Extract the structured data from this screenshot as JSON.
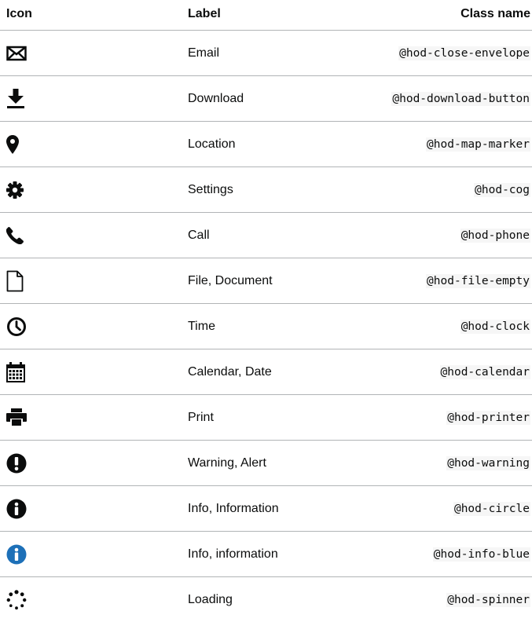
{
  "table": {
    "headers": {
      "icon": "Icon",
      "label": "Label",
      "class_name": "Class name"
    },
    "rows": [
      {
        "icon": "envelope-icon",
        "label": "Email",
        "class_name": "@hod-close-envelope"
      },
      {
        "icon": "download-icon",
        "label": "Download",
        "class_name": "@hod-download-button"
      },
      {
        "icon": "map-marker-icon",
        "label": "Location",
        "class_name": "@hod-map-marker"
      },
      {
        "icon": "cog-icon",
        "label": "Settings",
        "class_name": "@hod-cog"
      },
      {
        "icon": "phone-icon",
        "label": "Call",
        "class_name": "@hod-phone"
      },
      {
        "icon": "file-empty-icon",
        "label": "File, Document",
        "class_name": "@hod-file-empty"
      },
      {
        "icon": "clock-icon",
        "label": "Time",
        "class_name": "@hod-clock"
      },
      {
        "icon": "calendar-icon",
        "label": "Calendar, Date",
        "class_name": "@hod-calendar"
      },
      {
        "icon": "printer-icon",
        "label": "Print",
        "class_name": "@hod-printer"
      },
      {
        "icon": "warning-icon",
        "label": "Warning, Alert",
        "class_name": "@hod-warning"
      },
      {
        "icon": "info-circle-icon",
        "label": "Info, Information",
        "class_name": "@hod-circle"
      },
      {
        "icon": "info-blue-icon",
        "label": "Info, information",
        "class_name": "@hod-info-blue"
      },
      {
        "icon": "spinner-icon",
        "label": "Loading",
        "class_name": "@hod-spinner"
      }
    ]
  },
  "colors": {
    "text": "#0b0c0c",
    "border": "#b1b4b6",
    "info_blue": "#1d70b8"
  }
}
